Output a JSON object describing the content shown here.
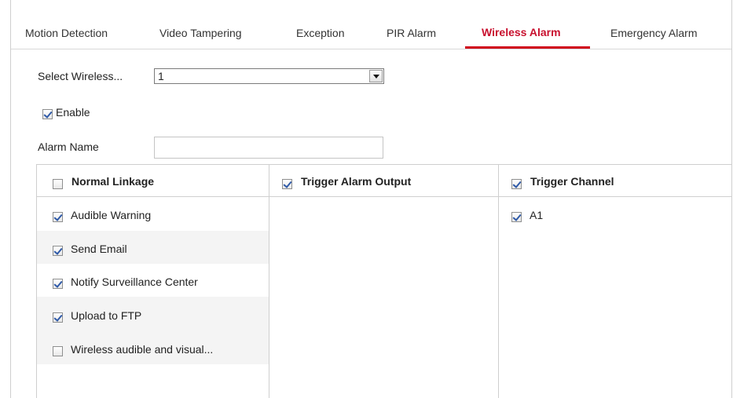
{
  "tabs": [
    {
      "label": "Motion Detection",
      "active": false
    },
    {
      "label": "Video Tampering",
      "active": false
    },
    {
      "label": "Exception",
      "active": false
    },
    {
      "label": "PIR Alarm",
      "active": false
    },
    {
      "label": "Wireless Alarm",
      "active": true
    },
    {
      "label": "Emergency Alarm",
      "active": false
    }
  ],
  "form": {
    "select_label": "Select Wireless...",
    "select_value": "1",
    "enable_label": "Enable",
    "enable_checked": true,
    "alarm_name_label": "Alarm Name",
    "alarm_name_value": ""
  },
  "linkage": {
    "normal": {
      "header": "Normal Linkage",
      "header_checked": false,
      "items": [
        {
          "label": "Audible Warning",
          "checked": true
        },
        {
          "label": "Send Email",
          "checked": true
        },
        {
          "label": "Notify Surveillance Center",
          "checked": true
        },
        {
          "label": "Upload to FTP",
          "checked": true
        },
        {
          "label": "Wireless audible and visual...",
          "checked": false
        }
      ]
    },
    "alarm_output": {
      "header": "Trigger Alarm Output",
      "header_checked": true
    },
    "channel": {
      "header": "Trigger Channel",
      "header_checked": true,
      "items": [
        {
          "label": "A1",
          "checked": true
        }
      ]
    }
  },
  "colors": {
    "active_tab": "#c8102e",
    "underline": "#d0021b",
    "checkmark": "#2f5aa8",
    "row_band": "#f4f4f4",
    "border": "#cfcfcf"
  }
}
